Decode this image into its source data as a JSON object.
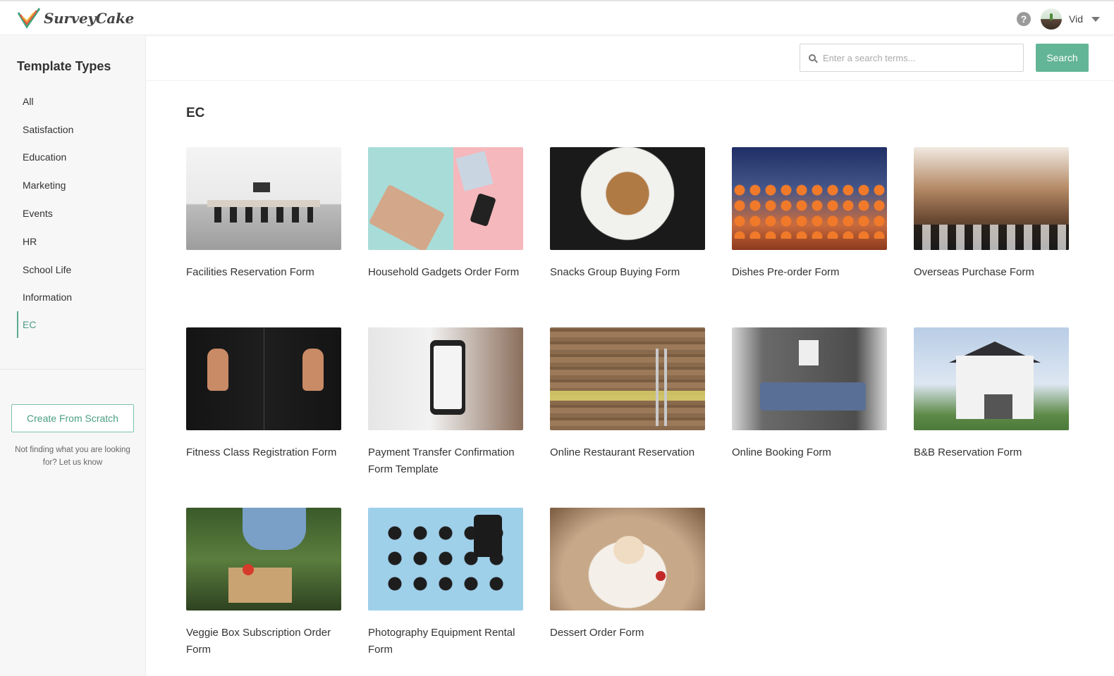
{
  "header": {
    "brand": "SurveyCake",
    "help_symbol": "?",
    "user_name": "Vid",
    "icons": [
      "surveycake-logo-icon",
      "help-icon",
      "avatar",
      "chevron-down-icon"
    ]
  },
  "sidebar": {
    "title": "Template Types",
    "items": [
      {
        "label": "All",
        "active": false
      },
      {
        "label": "Satisfaction",
        "active": false
      },
      {
        "label": "Education",
        "active": false
      },
      {
        "label": "Marketing",
        "active": false
      },
      {
        "label": "Events",
        "active": false
      },
      {
        "label": "HR",
        "active": false
      },
      {
        "label": "School Life",
        "active": false
      },
      {
        "label": "Information",
        "active": false
      },
      {
        "label": "EC",
        "active": true
      }
    ],
    "create_label": "Create From Scratch",
    "help_text": "Not finding what you are looking for? Let us know"
  },
  "search": {
    "placeholder": "Enter a search terms...",
    "value": "",
    "button_label": "Search"
  },
  "main": {
    "section_title": "EC",
    "templates": [
      {
        "title": "Facilities Reservation Form"
      },
      {
        "title": "Household Gadgets Order Form"
      },
      {
        "title": "Snacks Group Buying Form"
      },
      {
        "title": "Dishes Pre-order Form"
      },
      {
        "title": "Overseas Purchase Form"
      },
      {
        "title": "Fitness Class Registration Form"
      },
      {
        "title": "Payment Transfer Confirmation Form Template"
      },
      {
        "title": "Online Restaurant Reservation"
      },
      {
        "title": "Online Booking Form"
      },
      {
        "title": "B&B Reservation Form"
      },
      {
        "title": "Veggie Box Subscription Order Form"
      },
      {
        "title": "Photography Equipment Rental Form"
      },
      {
        "title": "Dessert Order Form"
      }
    ]
  },
  "colors": {
    "accent": "#63b597",
    "accent_text": "#4a9e84",
    "sidebar_bg": "#f7f7f7"
  }
}
